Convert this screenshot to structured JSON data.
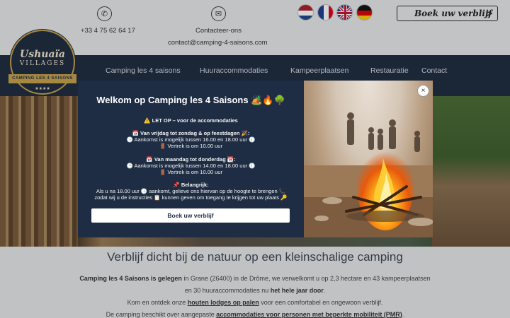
{
  "header": {
    "phone": "+33 4 75 62 64 17",
    "contact_label": "Contacteer-ons",
    "email": "contact@camping-4-saisons.com",
    "book_button": "Boek uw verblijf",
    "book_arrow": ">"
  },
  "logo": {
    "line1": "Ushuaïa",
    "line2": "VILLAGES",
    "ribbon": "CAMPING LES 4 SAISONS",
    "stars": "★★★★"
  },
  "nav": {
    "items": [
      {
        "label": "Camping les 4 saisons"
      },
      {
        "label": "Huuraccommodaties"
      },
      {
        "label": "Kampeerplaatsen"
      },
      {
        "label": "Restauratie"
      },
      {
        "label": "Contact"
      }
    ]
  },
  "modal": {
    "title": "Welkom op Camping les 4 Saisons 🏕️🔥🌳",
    "warning": "⚠️ LET OP – voor de accommodaties",
    "section1_title": "📅 Van vrijdag tot zondag & op feestdagen 🎉:",
    "section1_arrival": "🕓 Aankomst is mogelijk tussen 16.00 en 18.00 uur 🕕",
    "section1_departure": "🚪 Vertrek is om 10.00 uur",
    "section2_title": "📅 Van maandag tot donderdag 📆:",
    "section2_arrival": "🕑 Aankomst is mogelijk tussen 14.00 en 18.00 uur 🕕",
    "section2_departure": "🚪 Vertrek is om 10.00 uur",
    "important_title": "📌 Belangrijk:",
    "important_line1": "Als u na 18.00 uur 🕕 aankomt, gelieve ons hiervan op de hoogte te brengen 📞",
    "important_line2": "zodat wij u de instructies 📋 kunnen geven om toegang te krijgen tot uw plaats 🔑",
    "button": "Boek uw verblijf",
    "close": "×"
  },
  "content": {
    "heading": "Verblijf dicht bij de natuur op een kleinschalige camping",
    "p1_bold": "Camping les 4 Saisons is gelegen",
    "p1_rest": " in Grane (26400) in de Drôme, we verwelkomt u op 2,3 hectare en 43 kampeerplaatsen",
    "p2_start": "en 30 huuraccommodaties nu ",
    "p2_bold": "het hele jaar door",
    "p2_end": ".",
    "p3_start": "Kom en ontdek onze ",
    "p3_link": "houten lodges op palen",
    "p3_end": " voor een comfortabel en ongewoon verblijf.",
    "p4_start": "De camping beschikt over aangepaste ",
    "p4_link": "accommodaties voor personen met beperkte mobiliteit (PMR)",
    "p4_end": "."
  }
}
